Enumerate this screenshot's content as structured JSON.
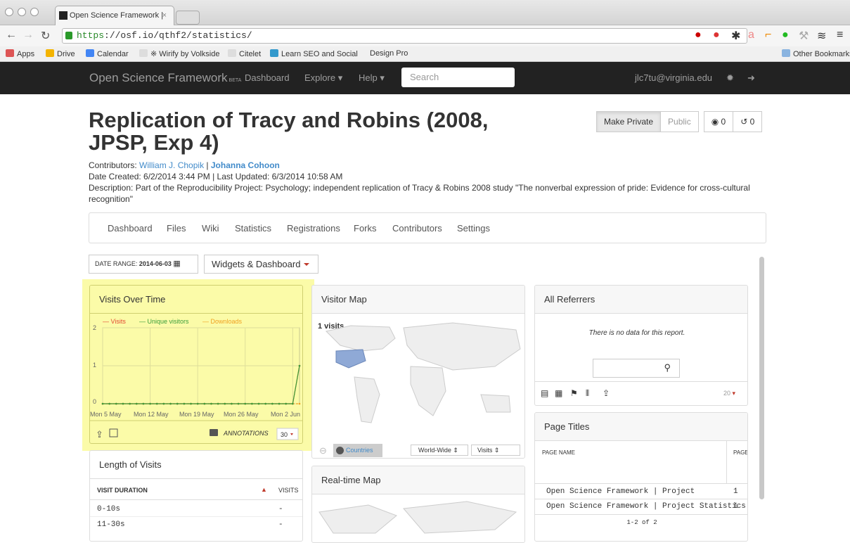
{
  "browser": {
    "tab_title": "Open Science Framework |",
    "tab_close": "×",
    "url_https": "https",
    "url_rest": "://osf.io/qthf2/statistics/",
    "bookmarks": [
      "Apps",
      "Drive",
      "Calendar",
      "※ Wirify by Volkside",
      "Citelet",
      "Learn SEO and Social",
      "Design Pro"
    ],
    "other_bookmarks": "Other Bookmarks"
  },
  "navbar": {
    "brand": "Open Science Framework",
    "beta": "BETA",
    "dashboard": "Dashboard",
    "explore": "Explore",
    "help": "Help",
    "search_placeholder": "Search",
    "user": "jlc7tu@virginia.edu"
  },
  "project": {
    "title": "Replication of Tracy and Robins (2008, JPSP, Exp 4)",
    "make_private": "Make Private",
    "public": "Public",
    "watch_count": "0",
    "fork_count": "0",
    "contributors_label": "Contributors:",
    "contributor1": "William J. Chopik",
    "separator": "|",
    "contributor2": "Johanna Cohoon",
    "dates": "Date Created: 6/2/2014 3:44 PM | Last Updated: 6/3/2014 10:58 AM",
    "description": "Description: Part of the Reproducibility Project: Psychology; independent replication of Tracy & Robins 2008 study \"The nonverbal expression of pride: Evidence for cross-cultural recognition\""
  },
  "subnav": [
    "Dashboard",
    "Files",
    "Wiki",
    "Statistics",
    "Registrations",
    "Forks",
    "Contributors",
    "Settings"
  ],
  "toolbar": {
    "date_range_label": "DATE RANGE:",
    "date_range_value": "2014-06-03",
    "widgets": "Widgets & Dashboard"
  },
  "visits_over_time": {
    "title": "Visits Over Time",
    "annotations": "ANNOTATIONS",
    "period": "30",
    "legend": [
      "— Visits",
      "— Unique visitors",
      "— Downloads"
    ]
  },
  "chart_data": {
    "type": "line",
    "x_tick_labels": [
      "Mon 5 May",
      "Mon 12 May",
      "Mon 19 May",
      "Mon 26 May",
      "Mon 2 Jun"
    ],
    "y_tick_labels": [
      "0",
      "1",
      "2"
    ],
    "ylim": [
      0,
      2
    ],
    "series": [
      {
        "name": "Visits",
        "color": "#e34a33",
        "points": "all 0 from 5 May to 2 Jun, 1 on 3 Jun"
      },
      {
        "name": "Unique visitors",
        "color": "#3b9e3b",
        "final_value": 1
      },
      {
        "name": "Downloads",
        "color": "#f0a020",
        "all_zero": true
      }
    ]
  },
  "visitor_map": {
    "title": "Visitor Map",
    "visits": "1 visits",
    "countries": "Countries",
    "region": "World-Wide",
    "metric": "Visits"
  },
  "all_referrers": {
    "title": "All Referrers",
    "empty": "There is no data for this report.",
    "limit": "20"
  },
  "length_of_visits": {
    "title": "Length of Visits",
    "col1": "VISIT DURATION",
    "col2": "VISITS",
    "rows": [
      {
        "label": "0-10s",
        "value": "-"
      },
      {
        "label": "11-30s",
        "value": "-"
      }
    ]
  },
  "realtime_map": {
    "title": "Real-time Map"
  },
  "page_titles": {
    "title": "Page Titles",
    "col1": "PAGE NAME",
    "col2": "PAGE",
    "rows": [
      {
        "name": "Open Science Framework | Project",
        "value": "1"
      },
      {
        "name": "Open Science Framework | Project Statistics",
        "value": "1"
      }
    ],
    "pagination": "1-2 of 2"
  }
}
